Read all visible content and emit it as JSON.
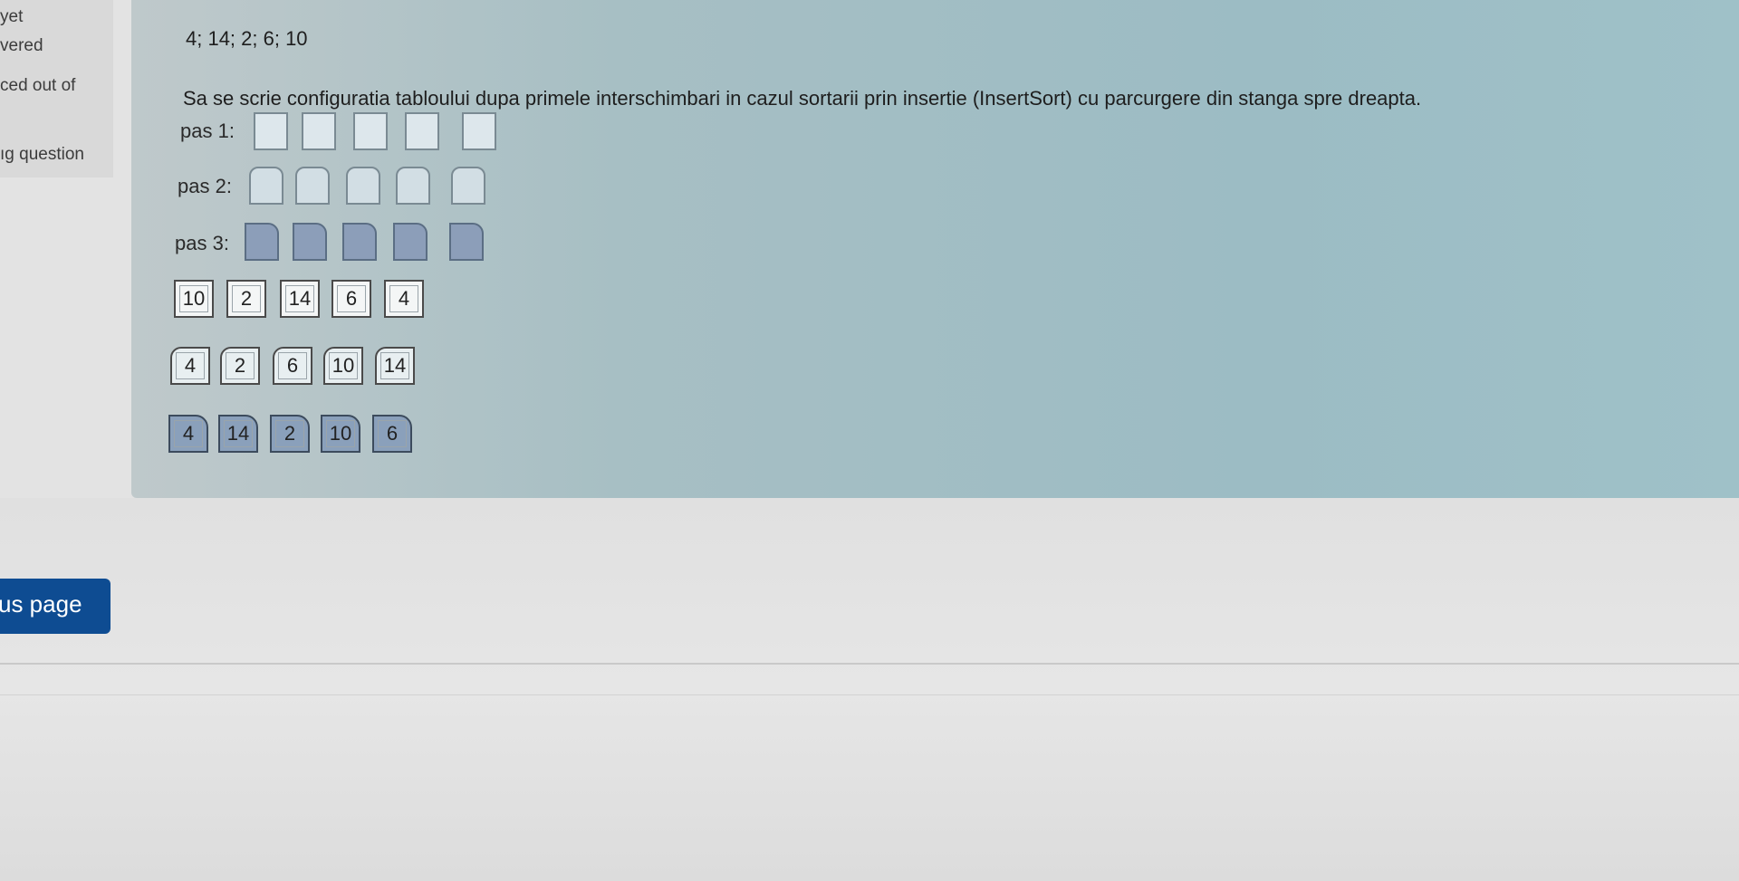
{
  "sidebar_info": {
    "line1": "yet",
    "line2": "vered",
    "line3": "ced out of",
    "line4": "ıg question"
  },
  "question": {
    "sequence": "4; 14; 2; 6; 10",
    "prompt": "Sa se scrie configuratia tabloului dupa primele interschimbari in cazul sortarii prin insertie (InsertSort) cu parcurgere din stanga spre dreapta.",
    "rows": [
      {
        "label": "pas 1:"
      },
      {
        "label": "pas 2:"
      },
      {
        "label": "pas 3:"
      }
    ],
    "tile_rows": [
      [
        "10",
        "2",
        "14",
        "6",
        "4"
      ],
      [
        "4",
        "2",
        "6",
        "10",
        "14"
      ],
      [
        "4",
        "14",
        "2",
        "10",
        "6"
      ]
    ]
  },
  "navigation": {
    "previous_label": "us page"
  }
}
